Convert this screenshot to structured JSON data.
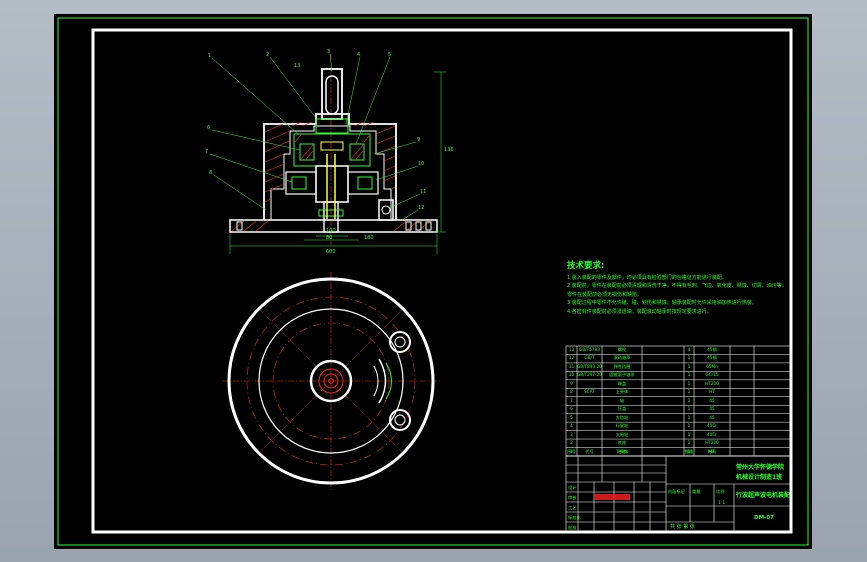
{
  "colors": {
    "background": "#000000",
    "frame": "#ffffff",
    "outline": "#ffffff",
    "section": "#ff2020",
    "hatch": "#ff2020",
    "center": "#ff2020",
    "dimension": "#2cff2c",
    "text": "#2cff2c",
    "part_green": "#2cff2c",
    "part_yellow": "#ffff33"
  },
  "drawing": {
    "top_dims": [
      "600",
      "80",
      "100",
      "180"
    ],
    "side_dim": "136",
    "balloons": [
      "1",
      "2",
      "3",
      "4",
      "5",
      "6",
      "7",
      "8",
      "9",
      "10",
      "11",
      "12",
      "13"
    ]
  },
  "notes": {
    "title": "技术要求:",
    "lines": [
      "1.装入装配的零件及部件，均必须具有检验部门的合格证方能进行装配。",
      "2.装配前，零件在装配前必须清理和清洗干净，不得有毛刺、飞边、氧化皮、锈蚀、切屑、油污等。",
      "  零件在装配前必须无损伤和缺陷。",
      "3.装配过程中零件不允许磕、碰、划伤和锈蚀。轴承装配时允许采用油加热进行热装。",
      "4.各密封件装配前必须浸透油，装配滚动轴承时按规定要求进行。"
    ]
  },
  "parts_table": {
    "rows": [
      [
        "13",
        "GB/T5783",
        "螺栓",
        "4",
        "45钢"
      ],
      [
        "12",
        "GB/T",
        "滚动轴承",
        "1",
        "45钢"
      ],
      [
        "11",
        "GB/T893-2000",
        "弹性挡圈",
        "1",
        "65Mn"
      ],
      [
        "10",
        "GB/T297-2000",
        "圆锥滚子轴承",
        "1",
        "GCr15"
      ],
      [
        "9",
        "",
        "端盖",
        "1",
        "HT200"
      ],
      [
        "8",
        "SCRT",
        "上壳体",
        "1",
        "HT"
      ],
      [
        "7",
        "",
        "轴",
        "1",
        "45"
      ],
      [
        "6",
        "",
        "压盖",
        "1",
        "45"
      ],
      [
        "5",
        "",
        "大齿轮",
        "1",
        "45"
      ],
      [
        "4",
        "",
        "行星轮",
        "1",
        "40Cr"
      ],
      [
        "3",
        "",
        "太阳轮",
        "1",
        "40Cr"
      ],
      [
        "2",
        "",
        "底座",
        "1",
        "HT200"
      ],
      [
        "1",
        "",
        "下壳体",
        "1",
        "HT"
      ]
    ],
    "header": [
      "序号",
      "代号",
      "名称",
      "数量",
      "材料"
    ]
  },
  "title_block": {
    "school": "常州大学怀德学院",
    "department": "机械设计制造1班",
    "drawing_name": "行波超声波电机装配",
    "drawing_no": "DM-07",
    "labels": [
      "设计",
      "审核",
      "工艺",
      "标准化",
      "批准",
      "阶段标记",
      "重量",
      "比例"
    ],
    "scale": "1:1",
    "sheet": "共 张 第 张"
  }
}
